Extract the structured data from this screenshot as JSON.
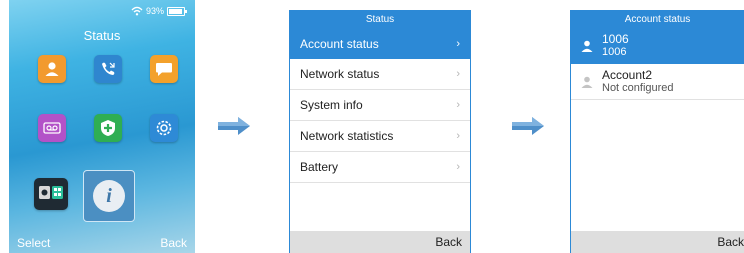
{
  "screen1": {
    "status_signal": "93%",
    "title": "Status",
    "icons": [
      "contacts-icon",
      "call-history-icon",
      "messages-icon",
      "voicemail-icon",
      "security-icon",
      "settings-icon",
      "apps-icon",
      "info-icon"
    ],
    "info_glyph": "i",
    "softkey_left": "Select",
    "softkey_right": "Back"
  },
  "screen2": {
    "title": "Status",
    "items": [
      {
        "label": "Account status"
      },
      {
        "label": "Network status"
      },
      {
        "label": "System info"
      },
      {
        "label": "Network statistics"
      },
      {
        "label": "Battery"
      }
    ],
    "softkey_right": "Back"
  },
  "screen3": {
    "title": "Account status",
    "accounts": [
      {
        "name": "1006",
        "detail": "1006"
      },
      {
        "name": "Account2",
        "detail": "Not configured"
      }
    ],
    "softkey_right": "Back"
  },
  "colors": {
    "accent": "#2c89d6",
    "arrow": "#4f8fc9"
  }
}
